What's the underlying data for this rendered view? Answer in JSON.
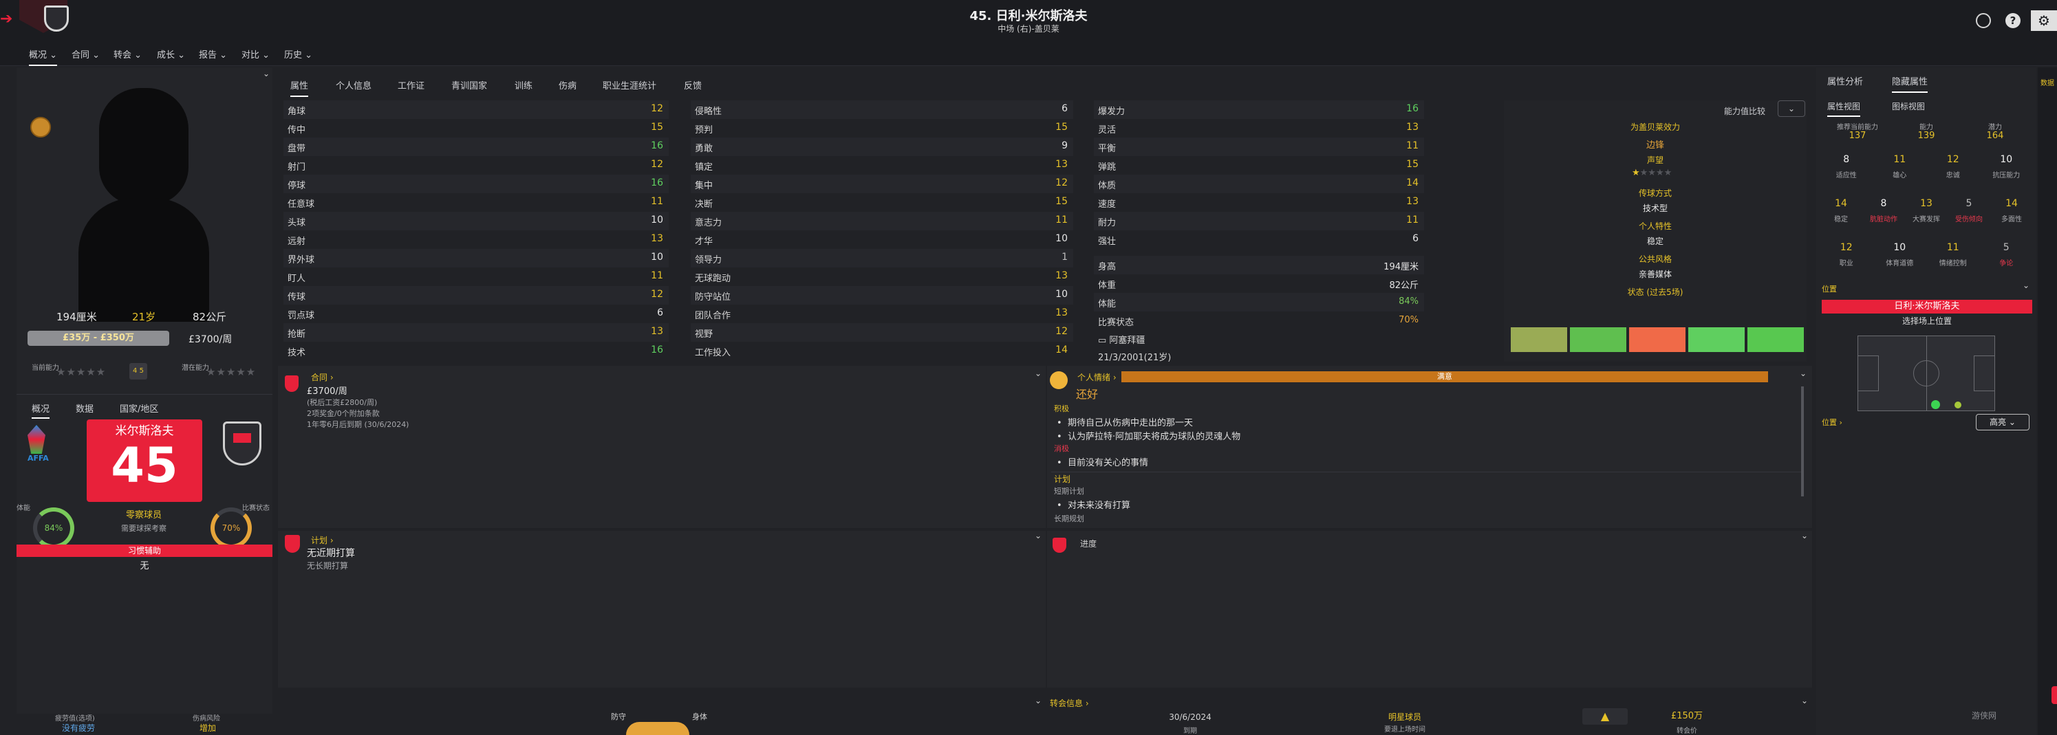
{
  "header": {
    "title": "45. 日利·米尔斯洛夫",
    "subtitle": "中场 (右)-盖贝莱",
    "back_icon": "back-arrow-icon"
  },
  "top_nav": [
    {
      "label": "概况"
    },
    {
      "label": "合同"
    },
    {
      "label": "转会"
    },
    {
      "label": "成长"
    },
    {
      "label": "报告"
    },
    {
      "label": "对比"
    },
    {
      "label": "历史"
    }
  ],
  "profile": {
    "height": "194厘米",
    "age": "21岁",
    "weight": "82公斤",
    "value_range": "£35万 - £350万",
    "wage": "£3700/周",
    "current_ability_label": "当前能力",
    "potential_label": "潜在能力",
    "nat_tabs": [
      "概况",
      "数据",
      "国家/地区"
    ],
    "shirt_name": "米尔斯洛夫",
    "shirt_number": "45",
    "federation": "AFFA",
    "squad_status": "零察球员",
    "squad_status_note": "需要球探考察",
    "condition_label": "体能",
    "condition": "84%",
    "match_sharpness_label": "比赛状态",
    "match_sharpness": "70%",
    "training_label": "习惯辅助",
    "training_value": "无",
    "footer_left_label": "疲劳值(选项)",
    "footer_left_value": "没有疲劳",
    "footer_right_label": "伤病风险",
    "footer_right_value": "增加",
    "accent": "#e8213a"
  },
  "tabs": [
    "属性",
    "个人信息",
    "工作证",
    "青训国家",
    "训练",
    "伤病",
    "职业生涯统计",
    "反馈"
  ],
  "attributes": {
    "technical": [
      {
        "name": "角球",
        "value": "12"
      },
      {
        "name": "传中",
        "value": "15"
      },
      {
        "name": "盘带",
        "value": "16"
      },
      {
        "name": "射门",
        "value": "12"
      },
      {
        "name": "停球",
        "value": "16"
      },
      {
        "name": "任意球",
        "value": "11"
      },
      {
        "name": "头球",
        "value": "10"
      },
      {
        "name": "远射",
        "value": "13"
      },
      {
        "name": "界外球",
        "value": "10"
      },
      {
        "name": "盯人",
        "value": "11"
      },
      {
        "name": "传球",
        "value": "12"
      },
      {
        "name": "罚点球",
        "value": "6"
      },
      {
        "name": "抢断",
        "value": "13"
      },
      {
        "name": "技术",
        "value": "16"
      }
    ],
    "mental": [
      {
        "name": "侵略性",
        "value": "6"
      },
      {
        "name": "预判",
        "value": "15"
      },
      {
        "name": "勇敢",
        "value": "9"
      },
      {
        "name": "镇定",
        "value": "13"
      },
      {
        "name": "集中",
        "value": "12"
      },
      {
        "name": "决断",
        "value": "15"
      },
      {
        "name": "意志力",
        "value": "11"
      },
      {
        "name": "才华",
        "value": "10"
      },
      {
        "name": "领导力",
        "value": "1"
      },
      {
        "name": "无球跑动",
        "value": "13"
      },
      {
        "name": "防守站位",
        "value": "10"
      },
      {
        "name": "团队合作",
        "value": "13"
      },
      {
        "name": "视野",
        "value": "12"
      },
      {
        "name": "工作投入",
        "value": "14"
      }
    ],
    "physical": [
      {
        "name": "爆发力",
        "value": "16"
      },
      {
        "name": "灵活",
        "value": "13"
      },
      {
        "name": "平衡",
        "value": "11"
      },
      {
        "name": "弹跳",
        "value": "15"
      },
      {
        "name": "体质",
        "value": "14"
      },
      {
        "name": "速度",
        "value": "13"
      },
      {
        "name": "耐力",
        "value": "11"
      },
      {
        "name": "强壮",
        "value": "6"
      }
    ],
    "info": [
      {
        "name": "身高",
        "value": "194厘米"
      },
      {
        "name": "体重",
        "value": "82公斤"
      },
      {
        "name": "体能",
        "value": "84%"
      },
      {
        "name": "比赛状态",
        "value": "70%"
      }
    ],
    "nation": "阿塞拜疆",
    "dob": "21/3/2001(21岁)"
  },
  "comparison": {
    "dropdown_label": "能力值比较",
    "effectiveness_label": "为盖贝莱效力",
    "position": "边锋",
    "reputation_label": "声望",
    "pref_style_label": "传球方式",
    "pref_style": "技术型",
    "personality_label": "个人特性",
    "personality": "稳定",
    "media_label": "公共风格",
    "media": "亲善媒体",
    "form_label": "状态 (过去5场)",
    "form": [
      0.6,
      0.7,
      0.3,
      0.8,
      0.75
    ]
  },
  "contract": {
    "title": "合同",
    "wage": "£3700/周",
    "note1": "(税后工资£2800/周)",
    "note2": "2项奖金/0个附加条款",
    "note3": "1年零6月后到期 (30/6/2024)"
  },
  "happiness": {
    "title": "个人情绪",
    "status": "还好",
    "bar_label": "满意",
    "positive_label": "积极",
    "positives": [
      "期待自己从伤病中走出的那一天",
      "认为萨拉特·阿加耶夫将成为球队的灵魂人物"
    ],
    "negative_label": "消极",
    "negatives": [
      "目前没有关心的事情"
    ],
    "plans_label": "计划",
    "short_label": "短期计划",
    "short_plans": [
      "对未来没有打算"
    ],
    "long_label": "长期规划"
  },
  "plans": {
    "title": "计划",
    "line1": "无近期打算",
    "line2": "无长期打算"
  },
  "progress": {
    "title": "进度"
  },
  "transfer": {
    "title": "转会信息",
    "date": "30/6/2024",
    "date_label": "到期",
    "star_label": "明星球员",
    "star_note": "要退上场时间",
    "fee": "£150万",
    "fee_label": "转会价"
  },
  "bottom_labels": {
    "defense": "防守",
    "physical": "身体"
  },
  "right_panel": {
    "tabs": [
      "属性分析",
      "隐藏属性"
    ],
    "subtabs": [
      "属性视图",
      "图标视图"
    ],
    "top": [
      {
        "label": "推荐当前能力",
        "value": "137"
      },
      {
        "label": "能力",
        "value": "139"
      },
      {
        "label": "潜力",
        "value": "164"
      }
    ],
    "rows": [
      [
        {
          "label": "适应性",
          "value": "8",
          "c": "white"
        },
        {
          "label": "雄心",
          "value": "11",
          "c": "yellow"
        },
        {
          "label": "忠诚",
          "value": "12",
          "c": "yellow"
        },
        {
          "label": "抗压能力",
          "value": "10",
          "c": "white"
        }
      ],
      [
        {
          "label": "稳定",
          "value": "14",
          "c": "yellow"
        },
        {
          "label": "肮脏动作",
          "value": "8",
          "c": "white",
          "lc": "red"
        },
        {
          "label": "大赛发挥",
          "value": "13",
          "c": "yellow"
        },
        {
          "label": "受伤倾向",
          "value": "5",
          "c": "gray",
          "lc": "red"
        },
        {
          "label": "多面性",
          "value": "14",
          "c": "yellow"
        }
      ],
      [
        {
          "label": "职业",
          "value": "12",
          "c": "yellow"
        },
        {
          "label": "体育道德",
          "value": "10",
          "c": "white"
        },
        {
          "label": "情绪控制",
          "value": "11",
          "c": "yellow"
        },
        {
          "label": "争论",
          "value": "5",
          "c": "gray",
          "lc": "red"
        }
      ]
    ],
    "position_label": "位置",
    "position_value": "日利·米尔斯洛夫",
    "position_select": "选择场上位置",
    "position_link": "位置",
    "highlight_btn": "高亮",
    "side_tab": "数据"
  },
  "watermark": "游侠网"
}
